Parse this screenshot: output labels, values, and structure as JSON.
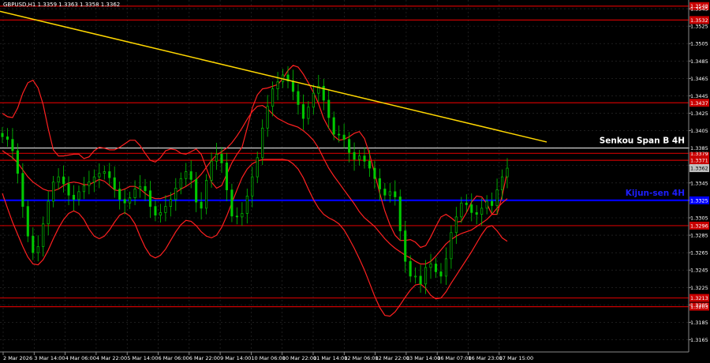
{
  "header": {
    "symbol": "GBPUSD,H1",
    "ohlc": "1.3359 1.3363 1.3358 1.3362"
  },
  "colors": {
    "background": "#000000",
    "grid": "#2f2f2f",
    "bull_candle": "#00c800",
    "bear_candle": "#00c800",
    "level_line": "#c80000",
    "trendline": "#ffd700",
    "kijun_line": "#0000ff",
    "senkou_line": "#ffffff",
    "bands": "#ff2020",
    "current_price_bg": "#c0c0c0"
  },
  "annotations": {
    "senkou": "Senkou Span B 4H",
    "kijun": "Kijun-sen 4H"
  },
  "chart_data": {
    "type": "candlestick",
    "ylim": [
      1.3151,
      1.3555
    ],
    "y_ticks": [
      1.3545,
      1.3525,
      1.3505,
      1.3485,
      1.3465,
      1.3445,
      1.3425,
      1.3405,
      1.3385,
      1.3365,
      1.3345,
      1.3325,
      1.3305,
      1.3285,
      1.3265,
      1.3245,
      1.3225,
      1.3205,
      1.3185,
      1.3165
    ],
    "x_labels": [
      "2 Mar 2026",
      "3 Mar 14:00",
      "4 Mar 06:00",
      "4 Mar 22:00",
      "5 Mar 14:00",
      "6 Mar 06:00",
      "6 Mar 22:00",
      "9 Mar 14:00",
      "10 Mar 06:00",
      "10 Mar 22:00",
      "11 Mar 14:00",
      "12 Mar 06:00",
      "12 Mar 22:00",
      "13 Mar 14:00",
      "16 Mar 07:00",
      "16 Mar 23:00",
      "17 Mar 15:00"
    ],
    "levels": [
      {
        "value": 1.3548,
        "label": "1.3548"
      },
      {
        "value": 1.3532,
        "label": "1.3532"
      },
      {
        "value": 1.3437,
        "label": "1.3437"
      },
      {
        "value": 1.3379,
        "label": "1.3379"
      },
      {
        "value": 1.3371,
        "label": "1.3371"
      },
      {
        "value": 1.3296,
        "label": "1.3296"
      },
      {
        "value": 1.3213,
        "label": "1.3213"
      },
      {
        "value": 1.3203,
        "label": "1.3203"
      }
    ],
    "price_labels": [
      {
        "value": 1.3385,
        "label": "1.3385",
        "kind": "senkou"
      },
      {
        "value": 1.3362,
        "label": "1.3362",
        "kind": "current"
      },
      {
        "value": 1.3325,
        "label": "1.3325",
        "kind": "kijun"
      }
    ],
    "senkou_value": 1.3385,
    "kijun_value": 1.3325,
    "trendline": [
      [
        0,
        1.3542
      ],
      [
        1,
        1.3392
      ]
    ],
    "close": [
      1.3398,
      1.3395,
      1.3382,
      1.3356,
      1.3318,
      1.3284,
      1.3265,
      1.3272,
      1.3298,
      1.3324,
      1.3346,
      1.3352,
      1.3344,
      1.3331,
      1.3326,
      1.3335,
      1.3342,
      1.3346,
      1.3352,
      1.3356,
      1.3358,
      1.3351,
      1.3338,
      1.3326,
      1.3322,
      1.3328,
      1.3338,
      1.3341,
      1.3336,
      1.3318,
      1.3308,
      1.3311,
      1.3318,
      1.3326,
      1.3339,
      1.335,
      1.3358,
      1.3349,
      1.3323,
      1.3316,
      1.3348,
      1.337,
      1.3378,
      1.3368,
      1.3337,
      1.3307,
      1.3306,
      1.331,
      1.333,
      1.3352,
      1.3374,
      1.3408,
      1.3433,
      1.3453,
      1.3461,
      1.3469,
      1.3462,
      1.345,
      1.3435,
      1.3419,
      1.3432,
      1.3448,
      1.3456,
      1.344,
      1.342,
      1.3401,
      1.34,
      1.3395,
      1.338,
      1.3372,
      1.3376,
      1.337,
      1.3362,
      1.335,
      1.3338,
      1.3331,
      1.3335,
      1.3329,
      1.329,
      1.3255,
      1.3238,
      1.3238,
      1.3229,
      1.3248,
      1.3252,
      1.3243,
      1.3238,
      1.3258,
      1.3288,
      1.3306,
      1.3322,
      1.332,
      1.3311,
      1.3309,
      1.3316,
      1.3324,
      1.3319,
      1.3337,
      1.3352,
      1.3362
    ],
    "bands": {
      "upper": [
        1.3425,
        1.3421,
        1.342,
        1.3431,
        1.3448,
        1.346,
        1.3463,
        1.3454,
        1.3435,
        1.3407,
        1.3383,
        1.3376,
        1.3376,
        1.3377,
        1.3378,
        1.3378,
        1.3373,
        1.3375,
        1.3382,
        1.3386,
        1.3385,
        1.3383,
        1.3383,
        1.3386,
        1.339,
        1.3394,
        1.3394,
        1.3388,
        1.3379,
        1.3371,
        1.3369,
        1.3374,
        1.3382,
        1.3384,
        1.3383,
        1.3379,
        1.3378,
        1.3381,
        1.3384,
        1.3378,
        1.3362,
        1.3346,
        1.3339,
        1.3342,
        1.3355,
        1.3368,
        1.3378,
        1.3386,
        1.3408,
        1.3431,
        1.3446,
        1.3453,
        1.3454,
        1.3456,
        1.3458,
        1.3465,
        1.3474,
        1.348,
        1.3478,
        1.347,
        1.346,
        1.3449,
        1.3436,
        1.3419,
        1.3408,
        1.3399,
        1.3394,
        1.3395,
        1.3398,
        1.3402,
        1.3404,
        1.3396,
        1.3378,
        1.3356,
        1.3333,
        1.3313,
        1.3297,
        1.3285,
        1.3279,
        1.3279,
        1.328,
        1.3277,
        1.3271,
        1.3273,
        1.3283,
        1.3295,
        1.3306,
        1.3309,
        1.3305,
        1.33,
        1.3301,
        1.3311,
        1.3323,
        1.333,
        1.3329,
        1.3321,
        1.3309,
        1.3309,
        1.333,
        1.3358
      ],
      "middle": [
        1.3382,
        1.3378,
        1.3374,
        1.3368,
        1.336,
        1.3352,
        1.3346,
        1.3342,
        1.3338,
        1.3336,
        1.3336,
        1.3338,
        1.3342,
        1.3345,
        1.3346,
        1.3345,
        1.3343,
        1.3343,
        1.3346,
        1.3349,
        1.3347,
        1.3342,
        1.3337,
        1.3336,
        1.3338,
        1.3341,
        1.3341,
        1.3338,
        1.3333,
        1.3329,
        1.3327,
        1.3327,
        1.3329,
        1.3331,
        1.3334,
        1.3338,
        1.3341,
        1.3345,
        1.3349,
        1.3355,
        1.3363,
        1.3371,
        1.3377,
        1.3381,
        1.3385,
        1.3391,
        1.3399,
        1.3408,
        1.3418,
        1.3427,
        1.3433,
        1.3434,
        1.343,
        1.3424,
        1.3419,
        1.3416,
        1.3413,
        1.3411,
        1.3409,
        1.3405,
        1.34,
        1.3394,
        1.3385,
        1.3373,
        1.3362,
        1.3353,
        1.3345,
        1.3337,
        1.3329,
        1.3321,
        1.3312,
        1.3305,
        1.33,
        1.3295,
        1.3288,
        1.3281,
        1.3275,
        1.327,
        1.3266,
        1.3262,
        1.3259,
        1.3255,
        1.3252,
        1.3252,
        1.3255,
        1.3261,
        1.3268,
        1.3275,
        1.328,
        1.3284,
        1.3287,
        1.3289,
        1.3291,
        1.3295,
        1.3299,
        1.3303,
        1.3309,
        1.3316,
        1.3322,
        1.3327
      ],
      "lower": [
        1.3333,
        1.3316,
        1.33,
        1.3286,
        1.3272,
        1.326,
        1.3252,
        1.3251,
        1.3257,
        1.3268,
        1.3281,
        1.3293,
        1.3303,
        1.331,
        1.3313,
        1.331,
        1.3303,
        1.3292,
        1.3284,
        1.3281,
        1.3284,
        1.3291,
        1.33,
        1.3308,
        1.3311,
        1.3307,
        1.3298,
        1.3284,
        1.3271,
        1.3262,
        1.3259,
        1.3262,
        1.3269,
        1.3279,
        1.3289,
        1.3297,
        1.3302,
        1.3301,
        1.3296,
        1.3289,
        1.3284,
        1.3282,
        1.3285,
        1.3294,
        1.3307,
        1.3322,
        1.3337,
        1.3351,
        1.3361,
        1.3367,
        1.337,
        1.3372,
        1.3372,
        1.3372,
        1.3372,
        1.3372,
        1.3371,
        1.3367,
        1.3361,
        1.3351,
        1.3338,
        1.3326,
        1.3316,
        1.3309,
        1.3305,
        1.3302,
        1.3298,
        1.3291,
        1.3281,
        1.327,
        1.3258,
        1.3245,
        1.323,
        1.3215,
        1.3202,
        1.3193,
        1.3192,
        1.3197,
        1.3205,
        1.3214,
        1.3222,
        1.3228,
        1.3229,
        1.3224,
        1.3216,
        1.3212,
        1.3213,
        1.322,
        1.323,
        1.3239,
        1.3248,
        1.3257,
        1.3266,
        1.3276,
        1.3286,
        1.3294,
        1.3296,
        1.329,
        1.3282,
        1.3278
      ]
    }
  }
}
